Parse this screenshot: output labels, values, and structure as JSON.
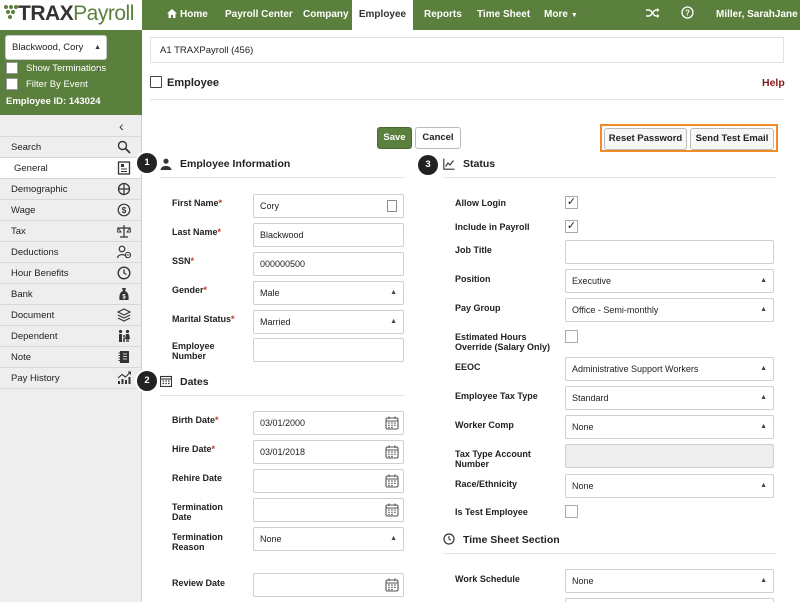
{
  "logo": {
    "bold": "TRAX",
    "light": "Payroll"
  },
  "nav": {
    "home": "Home",
    "payroll_center": "Payroll Center",
    "company": "Company",
    "employee": "Employee",
    "reports": "Reports",
    "time_sheet": "Time Sheet",
    "more": "More",
    "user": "Miller, SarahJane"
  },
  "sidebar": {
    "employee_select": "Blackwood, Cory",
    "show_terminations": "Show Terminations",
    "filter_by_event": "Filter By Event",
    "employee_id": "Employee ID: 143024",
    "items": [
      {
        "label": "Search",
        "icon": "search-icon"
      },
      {
        "label": "General",
        "icon": "id-card-icon"
      },
      {
        "label": "Demographic",
        "icon": "crosshair-icon"
      },
      {
        "label": "Wage",
        "icon": "dollar-icon"
      },
      {
        "label": "Tax",
        "icon": "scale-icon"
      },
      {
        "label": "Deductions",
        "icon": "user-minus-icon"
      },
      {
        "label": "Hour Benefits",
        "icon": "clock-icon"
      },
      {
        "label": "Bank",
        "icon": "money-bag-icon"
      },
      {
        "label": "Document",
        "icon": "layers-icon"
      },
      {
        "label": "Dependent",
        "icon": "family-icon"
      },
      {
        "label": "Note",
        "icon": "notebook-icon"
      },
      {
        "label": "Pay History",
        "icon": "chart-icon"
      }
    ]
  },
  "main": {
    "company": "A1 TRAXPayroll (456)",
    "section": "Employee",
    "help": "Help",
    "save": "Save",
    "cancel": "Cancel",
    "reset_password": "Reset Password",
    "send_test_email": "Send Test Email"
  },
  "badges": [
    "1",
    "2",
    "3"
  ],
  "employee_info": {
    "title": "Employee Information",
    "first_name": {
      "label": "First Name",
      "value": "Cory"
    },
    "last_name": {
      "label": "Last Name",
      "value": "Blackwood"
    },
    "ssn": {
      "label": "SSN",
      "value": "000000500"
    },
    "gender": {
      "label": "Gender",
      "value": "Male"
    },
    "marital_status": {
      "label": "Marital Status",
      "value": "Married"
    },
    "employee_number": {
      "label": "Employee Number",
      "value": ""
    }
  },
  "dates": {
    "title": "Dates",
    "birth_date": {
      "label": "Birth Date",
      "value": "03/01/2000"
    },
    "hire_date": {
      "label": "Hire Date",
      "value": "03/01/2018"
    },
    "rehire_date": {
      "label": "Rehire Date",
      "value": ""
    },
    "termination_date": {
      "label": "Termination Date",
      "value": ""
    },
    "termination_reason": {
      "label": "Termination Reason",
      "value": "None"
    },
    "review_date": {
      "label": "Review Date",
      "value": ""
    }
  },
  "status": {
    "title": "Status",
    "allow_login": {
      "label": "Allow Login",
      "checked": "✓"
    },
    "include_in_payroll": {
      "label": "Include in Payroll",
      "checked": "✓"
    },
    "job_title": {
      "label": "Job Title",
      "value": ""
    },
    "position": {
      "label": "Position",
      "value": "Executive"
    },
    "pay_group": {
      "label": "Pay Group",
      "value": "Office - Semi-monthly"
    },
    "estimated_hours": {
      "label": "Estimated Hours Override (Salary Only)",
      "checked": ""
    },
    "eeoc": {
      "label": "EEOC",
      "value": "Administrative Support Workers"
    },
    "employee_tax_type": {
      "label": "Employee Tax Type",
      "value": "Standard"
    },
    "worker_comp": {
      "label": "Worker Comp",
      "value": "None"
    },
    "tax_type_account": {
      "label": "Tax Type Account Number",
      "value": ""
    },
    "race_ethnicity": {
      "label": "Race/Ethnicity",
      "value": "None"
    },
    "is_test_employee": {
      "label": "Is Test Employee",
      "checked": ""
    }
  },
  "time_sheet": {
    "title": "Time Sheet Section",
    "work_schedule": {
      "label": "Work Schedule",
      "value": "None"
    }
  },
  "colors": {
    "brand": "#5b7f3d",
    "highlight": "#f08a24",
    "required": "#c0392b",
    "help": "#8b1a1a"
  }
}
